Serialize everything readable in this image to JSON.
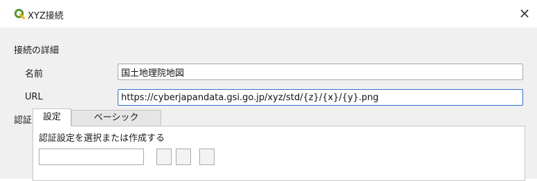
{
  "window": {
    "title": "XYZ接続",
    "close_label": "×",
    "app_icon": "qgis-logo-icon",
    "brand_color": "#589632"
  },
  "connection": {
    "section_title": "接続の詳細",
    "name_label": "名前",
    "name_value": "国土地理院地図",
    "url_label": "URL",
    "url_value": "https://cyberjapandata.gsi.go.jp/xyz/std/{z}/{x}/{y}.png"
  },
  "auth": {
    "label": "認証",
    "tabs": [
      {
        "label": "設定",
        "active": true
      },
      {
        "label": "ベーシック",
        "active": false
      }
    ],
    "panel_text": "認証設定を選択または作成する"
  }
}
